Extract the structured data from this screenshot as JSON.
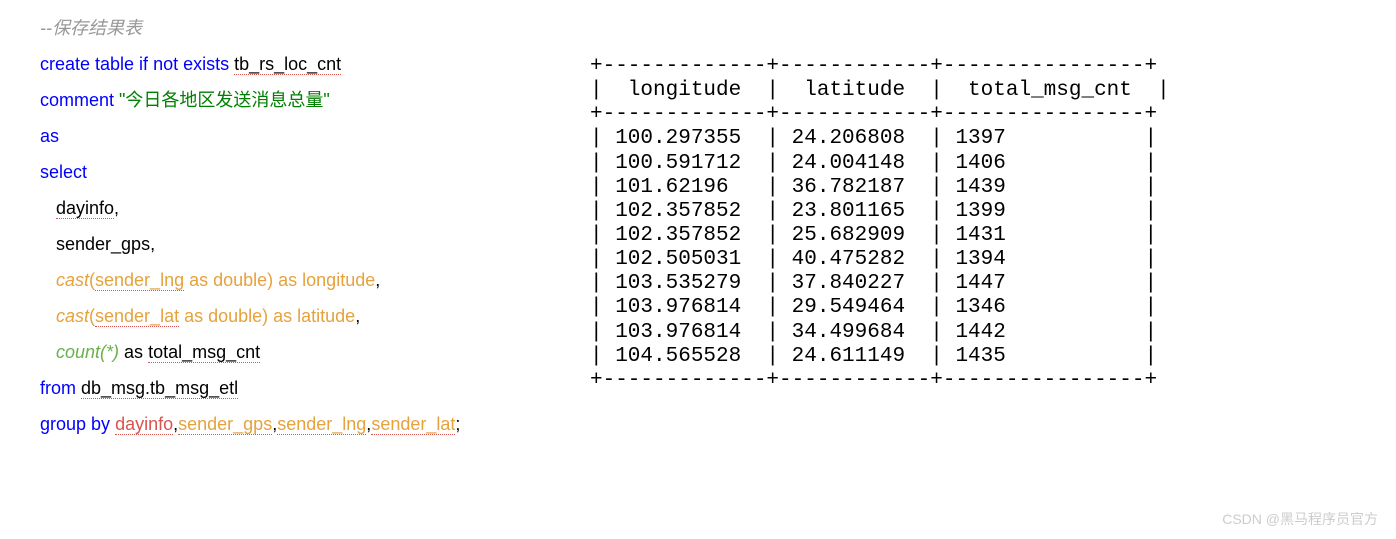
{
  "code": {
    "comment": "--保存结果表",
    "create_pre": "create table if not exists ",
    "create_name": "tb_rs_loc_cnt",
    "comment_kw": "comment ",
    "comment_str": "\"今日各地区发送消息总量\"",
    "as": "as",
    "select": "select",
    "col_dayinfo": "dayinfo",
    "col_sendergps": "sender_gps",
    "cast1_func": "cast",
    "cast1_open": "(",
    "cast1_arg": "sender_lng",
    "cast1_as": " as double) as longitude",
    "cast2_func": "cast",
    "cast2_open": "(",
    "cast2_arg": "sender_lat",
    "cast2_as": " as double) as latitude",
    "count_func": "count",
    "count_arg": "(*)",
    "count_as": " as ",
    "count_alias": "total_msg_cnt",
    "from_kw": "from ",
    "from_tbl": "db_msg.tb_msg_etl",
    "group_kw": "group  by ",
    "group1": "dayinfo",
    "group2": "sender_gps",
    "group3": "sender_lng",
    "group4": "sender_lat",
    "comma": ",",
    "semicolon": ";"
  },
  "table": {
    "sep_top": "+-------------+------------+----------------+",
    "header": "|  longitude  |  latitude  |  total_msg_cnt  |",
    "sep_mid": "+-------------+------------+----------------+",
    "rows": [
      "| 100.297355  | 24.206808  | 1397           |",
      "| 100.591712  | 24.004148  | 1406           |",
      "| 101.62196   | 36.782187  | 1439           |",
      "| 102.357852  | 23.801165  | 1399           |",
      "| 102.357852  | 25.682909  | 1431           |",
      "| 102.505031  | 40.475282  | 1394           |",
      "| 103.535279  | 37.840227  | 1447           |",
      "| 103.976814  | 29.549464  | 1346           |",
      "| 103.976814  | 34.499684  | 1442           |",
      "| 104.565528  | 24.611149  | 1435           |"
    ],
    "sep_bot": "+-------------+------------+----------------+"
  },
  "chart_data": {
    "type": "table",
    "columns": [
      "longitude",
      "latitude",
      "total_msg_cnt"
    ],
    "rows": [
      [
        100.297355,
        24.206808,
        1397
      ],
      [
        100.591712,
        24.004148,
        1406
      ],
      [
        101.62196,
        36.782187,
        1439
      ],
      [
        102.357852,
        23.801165,
        1399
      ],
      [
        102.357852,
        25.682909,
        1431
      ],
      [
        102.505031,
        40.475282,
        1394
      ],
      [
        103.535279,
        37.840227,
        1447
      ],
      [
        103.976814,
        29.549464,
        1346
      ],
      [
        103.976814,
        34.499684,
        1442
      ],
      [
        104.565528,
        24.611149,
        1435
      ]
    ]
  },
  "watermark": "CSDN @黑马程序员官方"
}
